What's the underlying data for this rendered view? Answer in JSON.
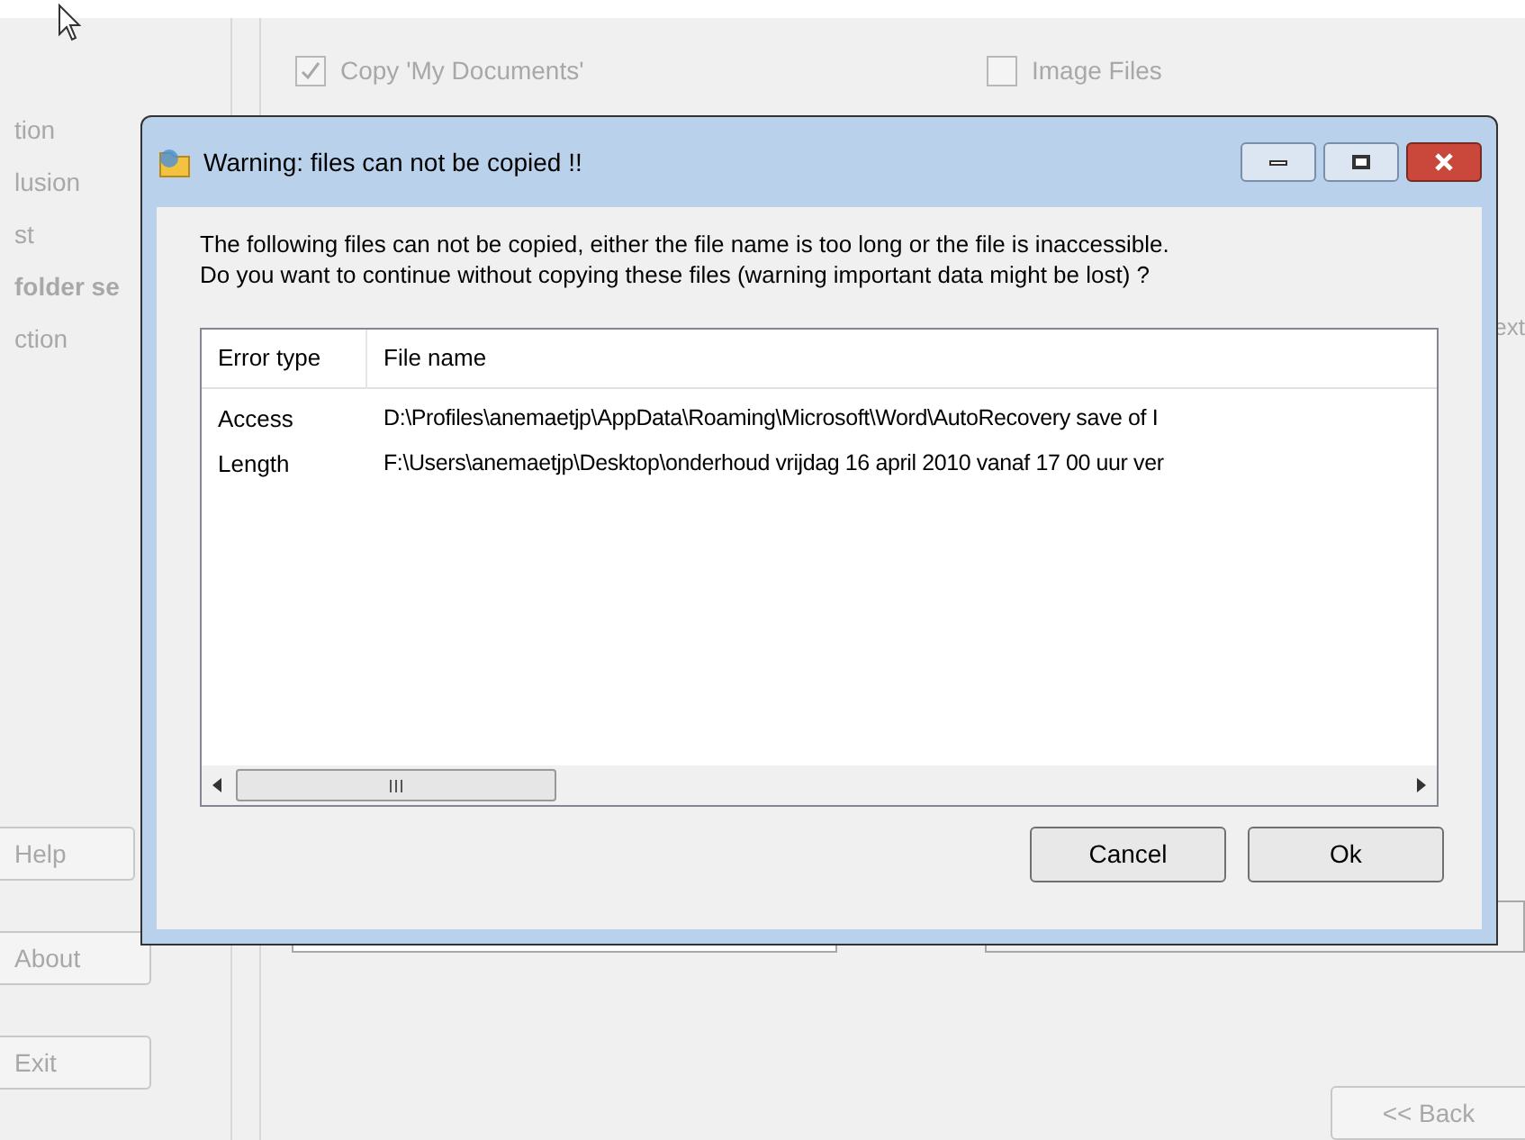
{
  "background": {
    "sidebar": {
      "items": [
        {
          "label": "tion",
          "bold": false
        },
        {
          "label": "lusion",
          "bold": false
        },
        {
          "label": "st",
          "bold": false
        },
        {
          "label": "folder se",
          "bold": true
        },
        {
          "label": "ction",
          "bold": false
        }
      ],
      "buttons": [
        "Help",
        "About",
        "Exit"
      ]
    },
    "options": [
      {
        "label": "Copy 'My Documents'",
        "checked": true
      },
      {
        "label": "Image Files",
        "checked": false
      }
    ],
    "side_text": "ext",
    "back_button": "<< Back"
  },
  "dialog": {
    "title": "Warning: files can not be copied !!",
    "message": [
      "The following files can not be copied, either the file name is too long or the file is inaccessible.",
      "Do you want to continue without copying these files (warning important data might be lost) ?"
    ],
    "columns": [
      "Error type",
      "File name"
    ],
    "rows": [
      {
        "error_type": "Access",
        "file_name": "D:\\Profiles\\anemaetjp\\AppData\\Roaming\\Microsoft\\Word\\AutoRecovery save of I"
      },
      {
        "error_type": "Length",
        "file_name": "F:\\Users\\anemaetjp\\Desktop\\onderhoud vrijdag 16 april 2010 vanaf 17 00 uur  ver"
      }
    ],
    "buttons": [
      "Cancel",
      "Ok"
    ]
  }
}
